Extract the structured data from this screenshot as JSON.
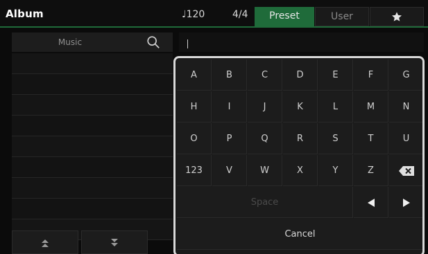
{
  "topbar": {
    "title": "Album",
    "tempo": "120",
    "time_signature": "4/4",
    "tabs": [
      {
        "label": "Preset",
        "active": true
      },
      {
        "label": "User",
        "active": false
      },
      {
        "label": "",
        "icon": "star-icon",
        "active": false
      }
    ],
    "accent_color": "#1f6b3a"
  },
  "list": {
    "header_label": "Music",
    "search_icon": "search-icon",
    "rows": [
      "",
      "",
      "",
      "",
      "",
      "",
      "",
      "",
      ""
    ],
    "page_up_icon": "double-chevron-up-icon",
    "page_down_icon": "double-chevron-down-icon"
  },
  "search": {
    "value": ""
  },
  "keyboard": {
    "row1": [
      "A",
      "B",
      "C",
      "D",
      "E",
      "F",
      "G"
    ],
    "row2": [
      "H",
      "I",
      "J",
      "K",
      "L",
      "M",
      "N"
    ],
    "row3": [
      "O",
      "P",
      "Q",
      "R",
      "S",
      "T",
      "U"
    ],
    "row4": [
      "123",
      "V",
      "W",
      "X",
      "Y",
      "Z"
    ],
    "backspace_icon": "backspace-icon",
    "space_label": "Space",
    "left_icon": "arrow-left-icon",
    "right_icon": "arrow-right-icon",
    "cancel_label": "Cancel"
  }
}
